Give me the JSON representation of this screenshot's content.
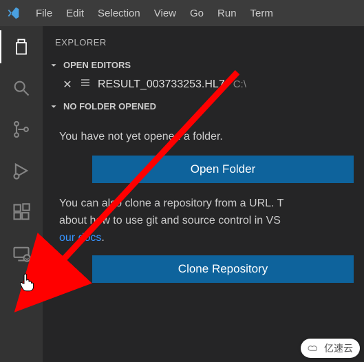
{
  "menubar": {
    "items": [
      "File",
      "Edit",
      "Selection",
      "View",
      "Go",
      "Run",
      "Term"
    ]
  },
  "activitybar": {
    "items": [
      {
        "name": "explorer",
        "active": true
      },
      {
        "name": "search",
        "active": false
      },
      {
        "name": "source-control",
        "active": false
      },
      {
        "name": "run-debug",
        "active": false
      },
      {
        "name": "extensions",
        "active": false
      },
      {
        "name": "remote",
        "active": false
      }
    ]
  },
  "sidebar": {
    "title": "EXPLORER",
    "openEditors": {
      "header": "OPEN EDITORS",
      "file": {
        "name": "RESULT_003733253.HL7",
        "path": "C:\\"
      }
    },
    "noFolder": {
      "header": "NO FOLDER OPENED",
      "msg1": "You have not yet opened a folder.",
      "openBtn": "Open Folder",
      "msg2a": "You can also clone a repository from a URL. T",
      "msg2b": "about how to use git and source control in VS",
      "docsLink": "our docs",
      "period": ".",
      "cloneBtn": "Clone Repository"
    }
  },
  "watermark": "亿速云"
}
